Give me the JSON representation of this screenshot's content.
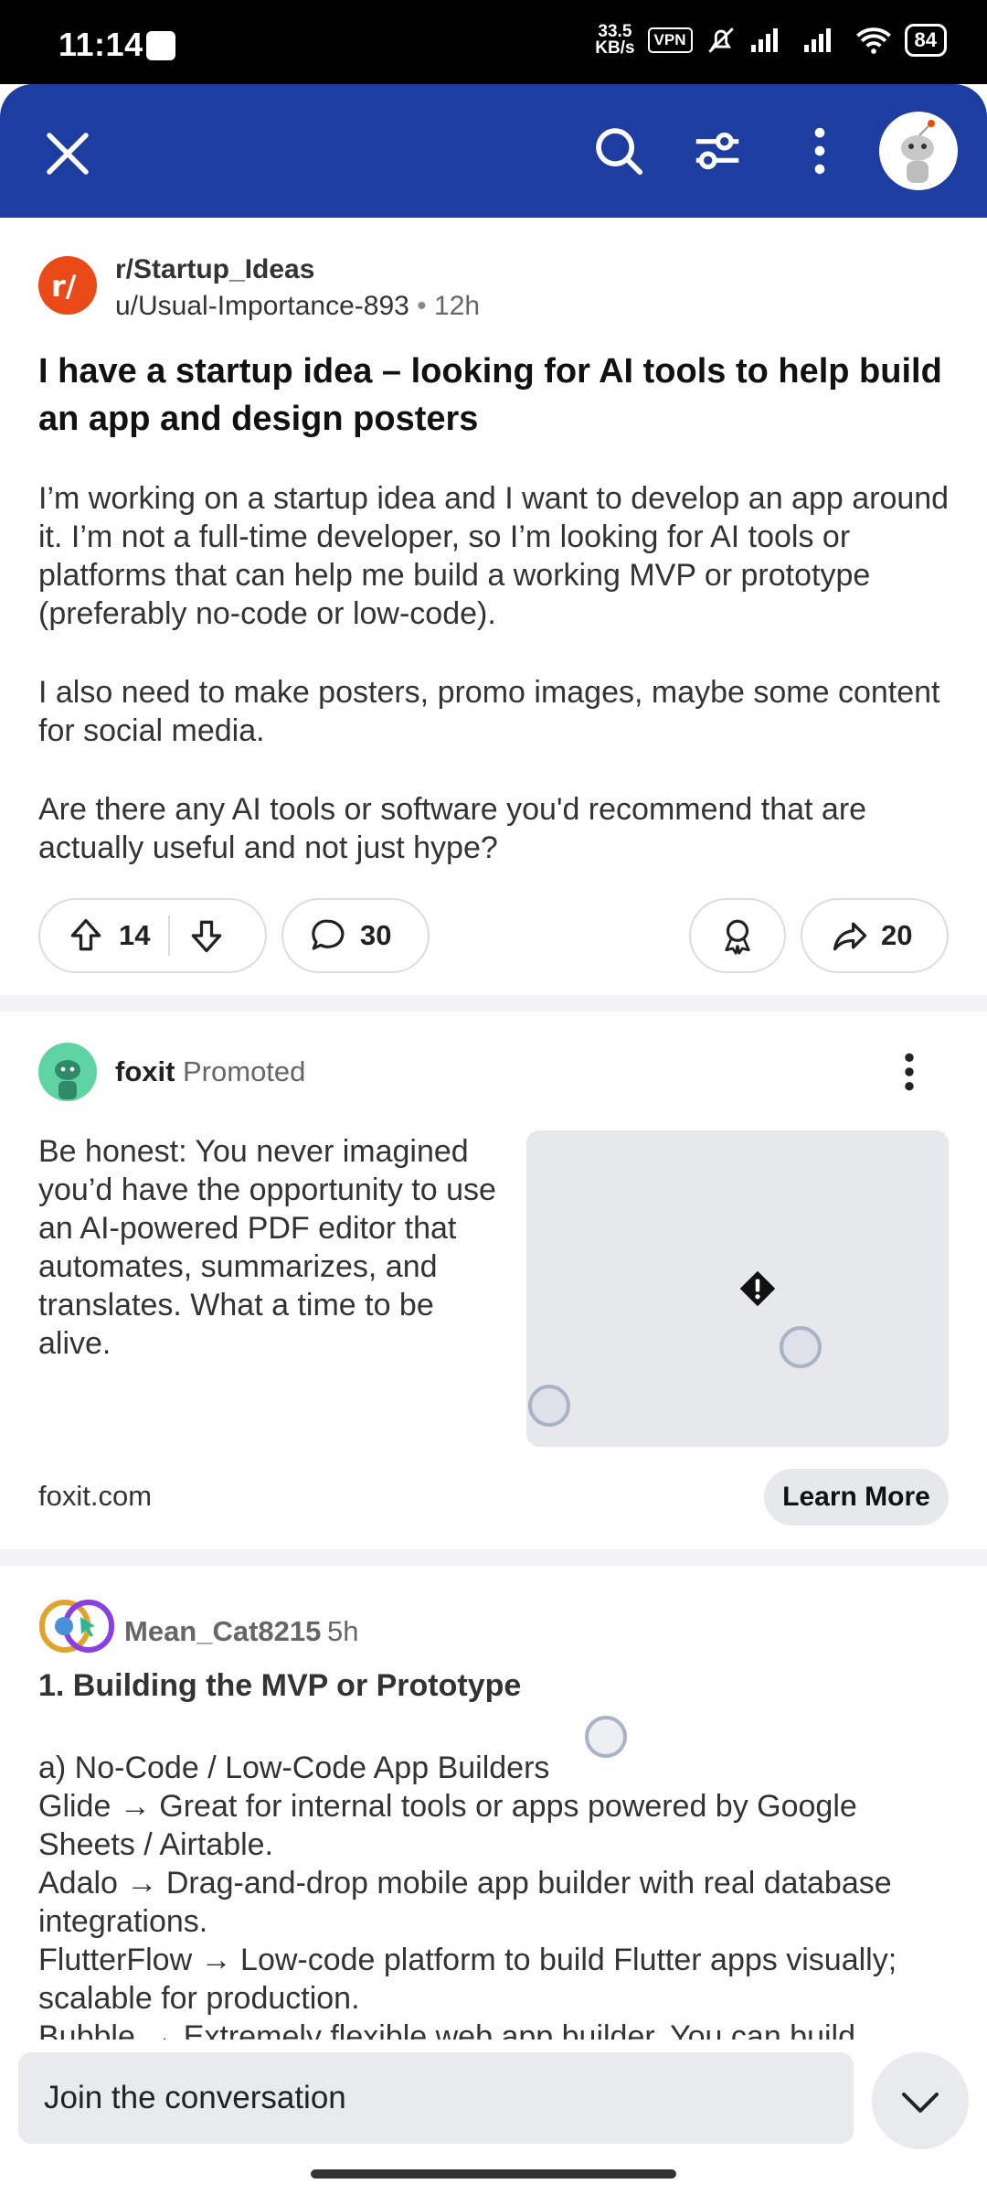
{
  "status_bar": {
    "time": "11:14",
    "net_speed_value": "33.5",
    "net_speed_unit": "KB/s",
    "vpn": "VPN",
    "battery": "84"
  },
  "app_bar": {
    "icons": [
      "close-icon",
      "search-icon",
      "filter-icon",
      "more-vertical-icon",
      "avatar"
    ]
  },
  "post": {
    "subreddit": "r/Startup_Ideas",
    "author": "u/Usual-Importance-893",
    "separator": "•",
    "age": "12h",
    "title": "I have a startup idea – looking for AI tools to help build an app and design posters",
    "body": [
      "I’m working on a startup idea and I want to develop an app around it. I’m not a full-time developer, so I’m looking for AI tools or platforms that can help me build a working MVP or prototype (preferably no-code or low-code).",
      "I also need to make posters, promo images, maybe some content for social media.",
      "Are there any AI tools or software you'd recommend that are actually useful and not just hype?"
    ],
    "upvotes": "14",
    "comments": "30",
    "shares": "20"
  },
  "ad": {
    "advertiser": "foxit",
    "promoted_label": "Promoted",
    "text": "Be honest: You never imagined you’d have the opportunity to use an AI-powered PDF editor that automates, summarizes, and translates. What a time to be alive.",
    "domain": "foxit.com",
    "cta": "Learn More"
  },
  "comment": {
    "username": "Mean_Cat8215",
    "age": "5h",
    "heading": "1. Building the MVP or Prototype",
    "lines": [
      "a) No-Code / Low-Code App Builders",
      "Glide → Great for internal tools or apps powered by Google Sheets / Airtable.",
      "Adalo → Drag-and-drop mobile app builder with real database integrations.",
      "FlutterFlow → Low-code platform to build Flutter apps visually; scalable for production.",
      "Bubble → Extremely flexible web app builder. You can build"
    ]
  },
  "bottom_bar": {
    "input_placeholder": "Join the conversation"
  },
  "colors": {
    "app_bar": "#1d3ea0",
    "subreddit_icon": "#ea4a17",
    "separator": "#f2f3f5"
  }
}
